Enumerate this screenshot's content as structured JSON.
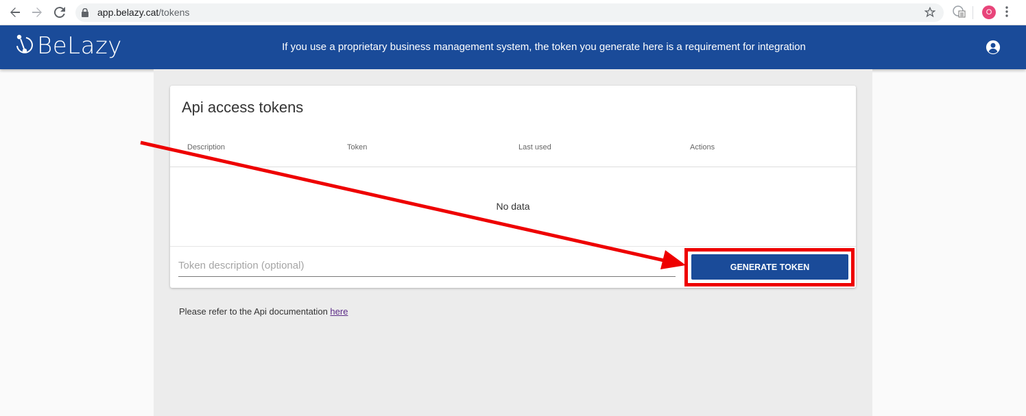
{
  "browser": {
    "url_host": "app.belazy.cat",
    "url_path": "/tokens",
    "profile_initial": "O"
  },
  "header": {
    "logo_text": "BeLazy",
    "message": "If you use a proprietary business management system, the token you generate here is a requirement for integration"
  },
  "card": {
    "title": "Api access tokens",
    "columns": [
      "Description",
      "Token",
      "Last used",
      "Actions"
    ],
    "empty_text": "No data",
    "input_placeholder": "Token description (optional)",
    "button_label": "GENERATE TOKEN"
  },
  "doc_note": {
    "text": "Please refer to the Api documentation ",
    "link": "here"
  },
  "colors": {
    "brand": "#1a4b99",
    "annotation": "#ee0000"
  },
  "icons": [
    "back-icon",
    "forward-icon",
    "reload-icon",
    "lock-icon",
    "star-icon",
    "extension-icon",
    "menu-icon",
    "account-icon"
  ]
}
